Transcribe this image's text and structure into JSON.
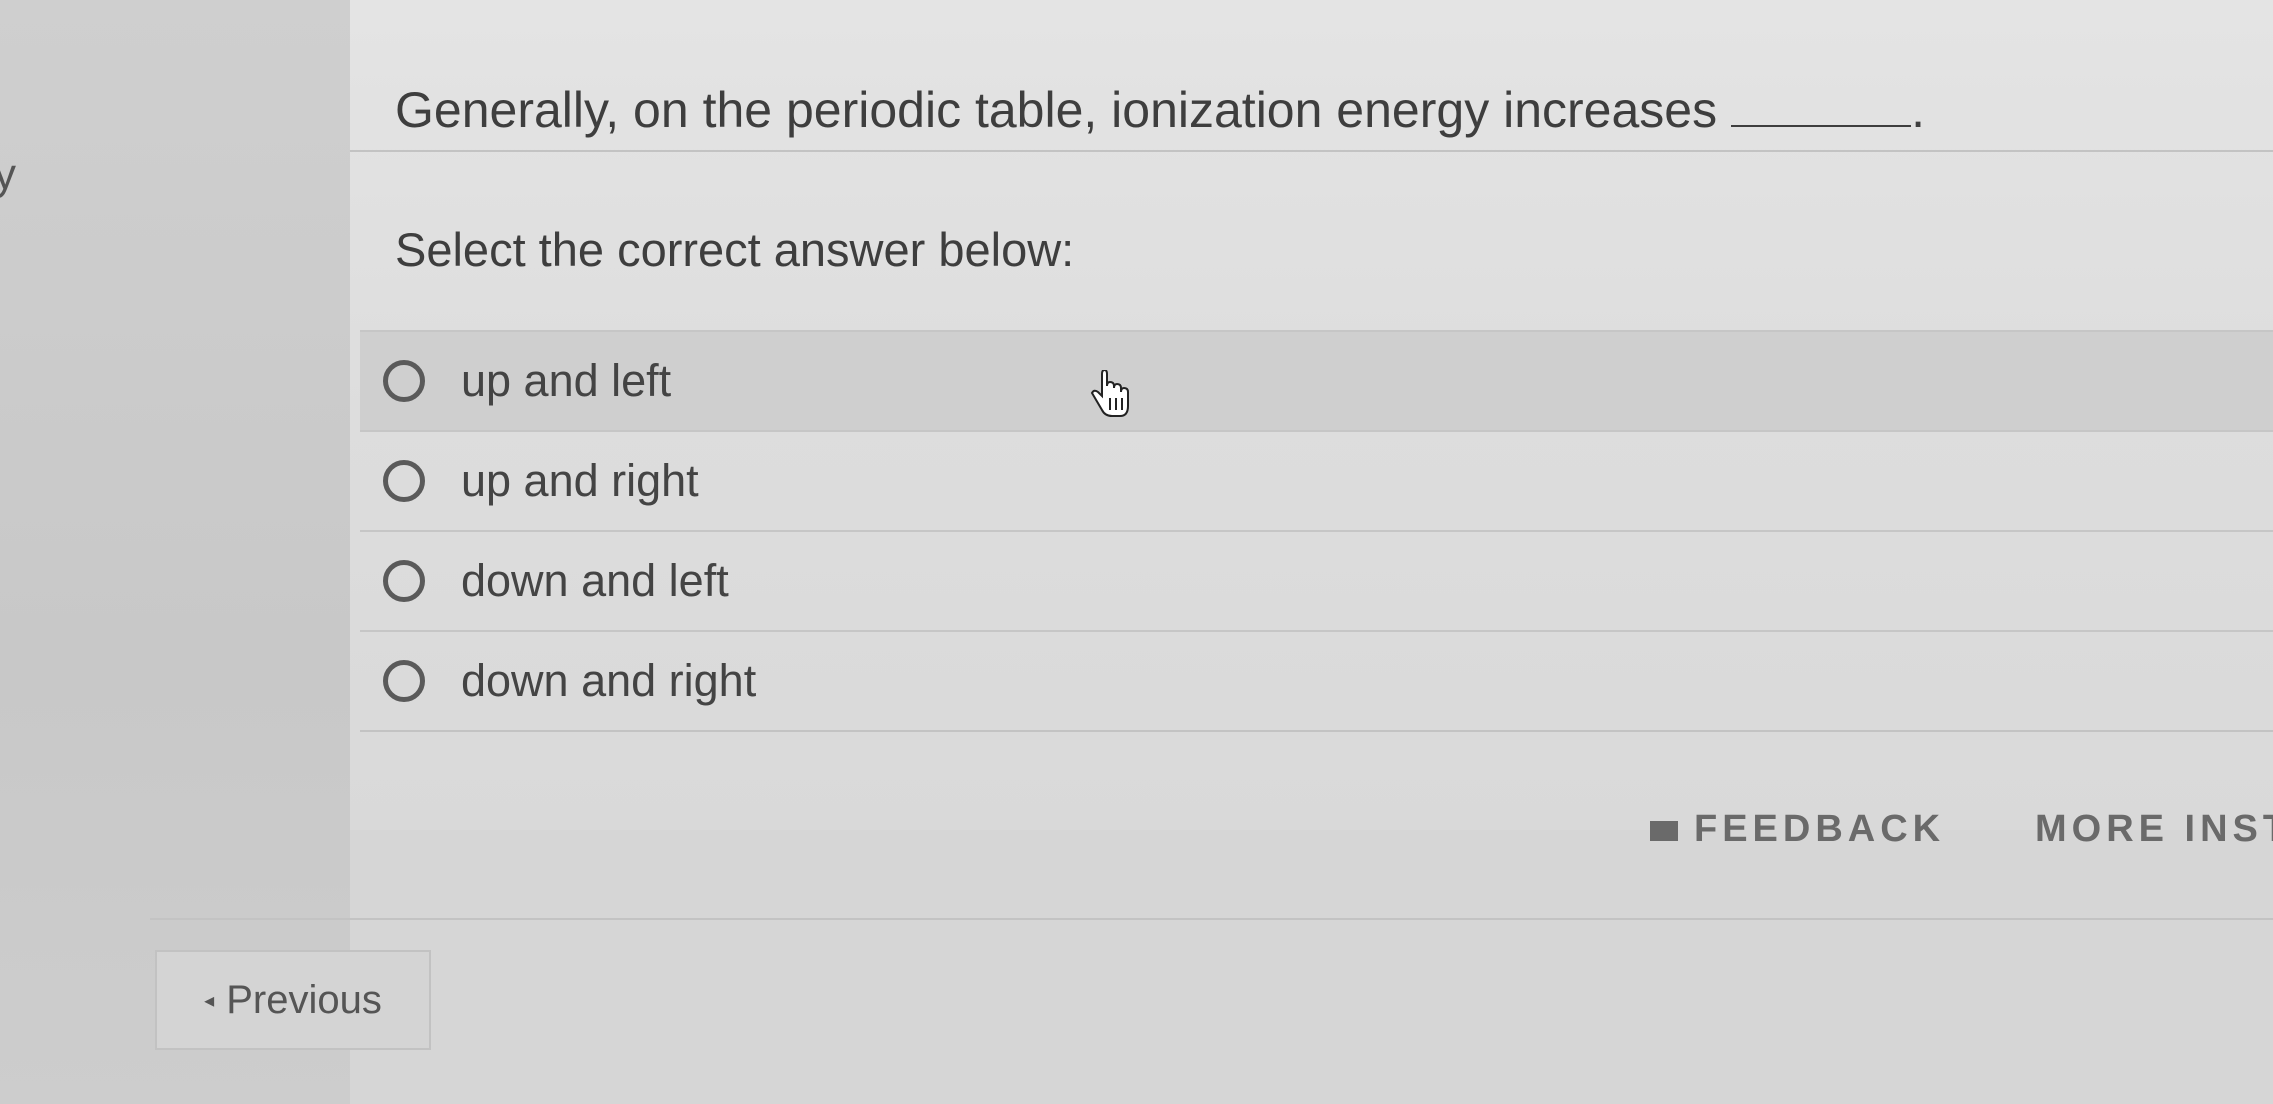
{
  "side_fragment": "y",
  "question": {
    "text": "Generally, on the periodic table, ionization energy increases",
    "end_punct": "."
  },
  "prompt": "Select the correct answer below:",
  "options": [
    {
      "label": "up and left"
    },
    {
      "label": "up and right"
    },
    {
      "label": "down and left"
    },
    {
      "label": "down and right"
    }
  ],
  "footer": {
    "feedback_label": "FEEDBACK",
    "more_label": "MORE INST"
  },
  "nav": {
    "previous_label": "Previous"
  }
}
